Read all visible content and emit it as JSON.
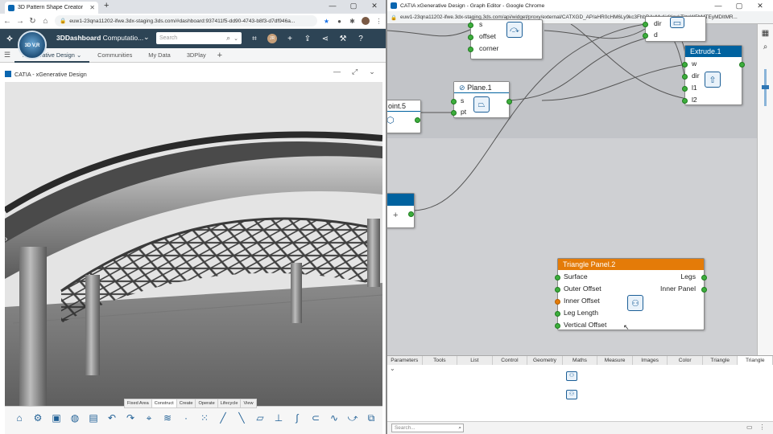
{
  "left_browser": {
    "tab_title": "3D Pattern Shape Creator",
    "url": "euw1-23qna11202-ifwe.3dx-staging.3ds.com/#dashboard:937411f5-dd90-4743-b8f3-d7df946a...",
    "window_controls": [
      "—",
      "▢",
      "✕"
    ]
  },
  "dashboard": {
    "compass_label": "3D V,R",
    "app_name_bold": "3DDashboard",
    "app_name_rest": " Computatio...",
    "search_placeholder": "Search",
    "avatar_initials": "JR"
  },
  "app_tabs": [
    "xGenerative Design",
    "Communities",
    "My Data",
    "3DPlay"
  ],
  "frame": {
    "title": "CATIA - xGenerative Design"
  },
  "action_bar": {
    "tabs": [
      "Fixed Area",
      "Construct",
      "Create",
      "Operate",
      "Lifecycle",
      "View"
    ],
    "active_tab": "Construct"
  },
  "right_browser": {
    "title": "CATIA xGenerative Design - Graph Editor - Google Chrome",
    "url": "euw1-23qna11202-ifwe.3dx-staging.3ds.com/api/widget/proxy/external/CATXGD_AP/aHR0cHM6Ly9kc3FhbDAxMy1idXoxLTIzcW5hMTEyMDItMR..."
  },
  "graph": {
    "node_top": {
      "ports": [
        "s",
        "offset",
        "corner"
      ]
    },
    "node_dl": {
      "ports": [
        "dir",
        "d"
      ]
    },
    "extrude": {
      "title": "Extrude.1",
      "ports": [
        "w",
        "dir",
        "l1",
        "l2"
      ]
    },
    "plane": {
      "title": "Plane.1",
      "ports": [
        "s",
        "pt"
      ]
    },
    "point": {
      "title": "oint.5"
    },
    "collapsed_plus": "+",
    "triangle": {
      "title": "Triangle Panel.2",
      "inputs": [
        "Surface",
        "Outer Offset",
        "Inner Offset",
        "Leg Length",
        "Vertical Offset"
      ],
      "outputs": [
        "Legs",
        "Inner Panel"
      ]
    }
  },
  "library_tabs": [
    "Parameters",
    "Tools",
    "List",
    "Control",
    "Geometry",
    "Maths",
    "Measure",
    "Images",
    "Color",
    "Triangle",
    "Triangle"
  ],
  "library_active": "Triangle",
  "graph_search_placeholder": "Search...",
  "colors": {
    "node_blue": "#00629f",
    "node_orange": "#e47b08",
    "port_green": "#3dae3d",
    "topbar": "#2d4455"
  }
}
